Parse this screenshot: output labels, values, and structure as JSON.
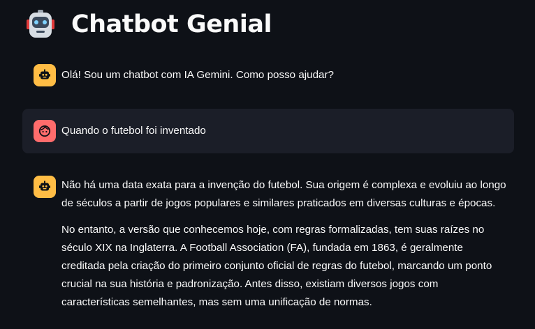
{
  "app": {
    "title": "Chatbot Genial",
    "title_icon": "robot-face-emoji"
  },
  "colors": {
    "background": "#0e1117",
    "user_bubble": "#1b1e28",
    "bot_avatar": "#ffbd45",
    "user_avatar": "#ff6c6c",
    "text": "#fafafa"
  },
  "messages": [
    {
      "role": "assistant",
      "avatar_icon": "smart-toy-icon",
      "paragraphs": [
        "Olá! Sou um chatbot com IA Gemini. Como posso ajudar?"
      ]
    },
    {
      "role": "user",
      "avatar_icon": "face-icon",
      "paragraphs": [
        "Quando o futebol foi inventado"
      ]
    },
    {
      "role": "assistant",
      "avatar_icon": "smart-toy-icon",
      "paragraphs": [
        "Não há uma data exata para a invenção do futebol. Sua origem é complexa e evoluiu ao longo de séculos a partir de jogos populares e similares praticados em diversas culturas e épocas.",
        "No entanto, a versão que conhecemos hoje, com regras formalizadas, tem suas raízes no século XIX na Inglaterra. A Football Association (FA), fundada em 1863, é geralmente creditada pela criação do primeiro conjunto oficial de regras do futebol, marcando um ponto crucial na sua história e padronização. Antes disso, existiam diversos jogos com características semelhantes, mas sem uma unificação de normas."
      ]
    }
  ]
}
